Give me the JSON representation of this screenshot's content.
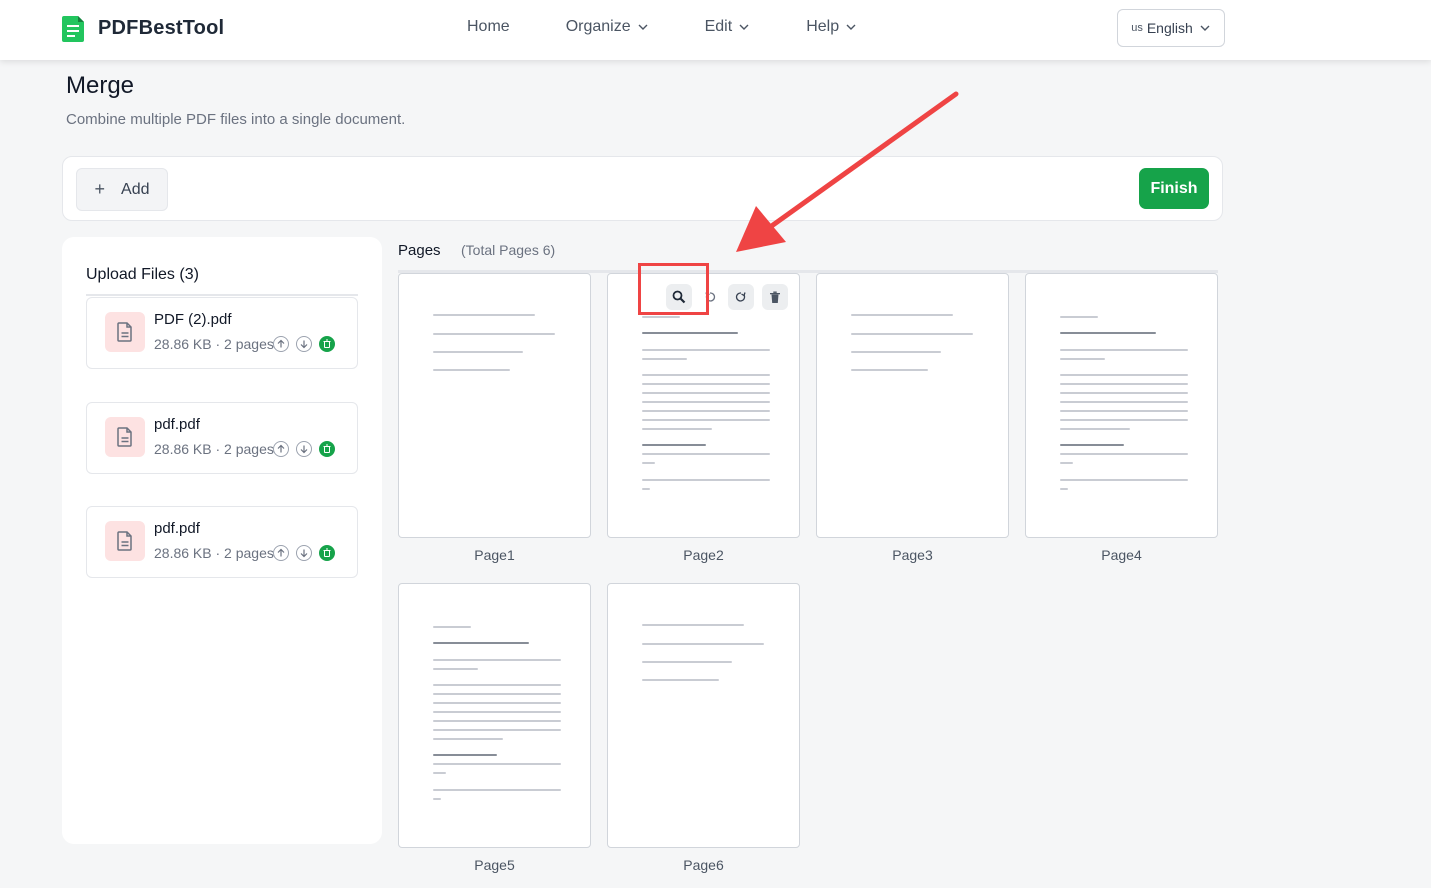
{
  "header": {
    "brand": "PDFBestTool",
    "nav": [
      {
        "label": "Home",
        "has_dropdown": false
      },
      {
        "label": "Organize",
        "has_dropdown": true
      },
      {
        "label": "Edit",
        "has_dropdown": true
      },
      {
        "label": "Help",
        "has_dropdown": true
      }
    ],
    "language": {
      "flag": "us",
      "label": "English"
    }
  },
  "main": {
    "title": "Merge",
    "subtitle": "Combine multiple PDF files into a single document.",
    "toolbar": {
      "add_label": "Add",
      "finish_label": "Finish"
    }
  },
  "upload": {
    "title": "Upload Files (3)",
    "files": [
      {
        "name": "PDF (2).pdf",
        "meta": "28.86 KB · 2 pages"
      },
      {
        "name": "pdf.pdf",
        "meta": "28.86 KB · 2 pages"
      },
      {
        "name": "pdf.pdf",
        "meta": "28.86 KB · 2 pages"
      }
    ]
  },
  "pages": {
    "heading": "Pages",
    "total": "(Total Pages 6)",
    "items": [
      {
        "label": "Page1"
      },
      {
        "label": "Page2"
      },
      {
        "label": "Page3"
      },
      {
        "label": "Page4"
      },
      {
        "label": "Page5"
      },
      {
        "label": "Page6"
      }
    ]
  },
  "icons": {
    "zoom": "magnifier-icon",
    "rotate_left": "rotate-left-icon",
    "rotate_right": "rotate-right-icon",
    "delete": "trash-icon"
  },
  "colors": {
    "brand_green": "#16a34a",
    "file_icon_bg": "#fde2e2",
    "annotation_red": "#ef4444"
  }
}
